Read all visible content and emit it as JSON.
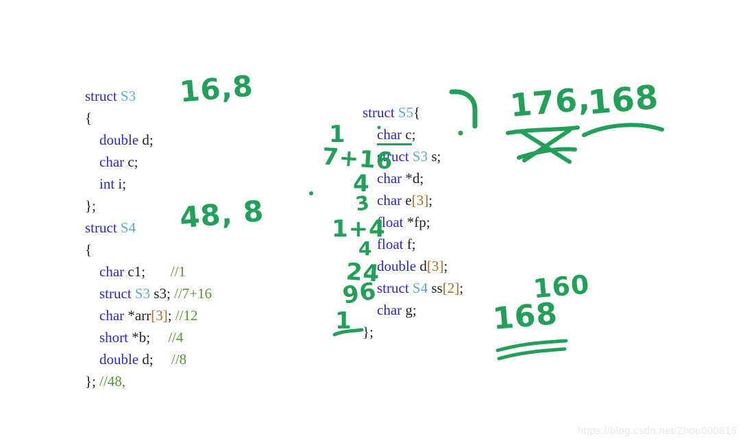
{
  "code_blocks": {
    "s3": {
      "lines": [
        [
          {
            "t": "struct ",
            "c": "kw"
          },
          {
            "t": "S3",
            "c": "typ"
          }
        ],
        [
          {
            "t": "{",
            "c": "id"
          }
        ],
        [
          {
            "t": "    ",
            "c": "id"
          },
          {
            "t": "double",
            "c": "kw"
          },
          {
            "t": " d;",
            "c": "id"
          }
        ],
        [
          {
            "t": "    ",
            "c": "id"
          },
          {
            "t": "char",
            "c": "kw"
          },
          {
            "t": " c;",
            "c": "id"
          }
        ],
        [
          {
            "t": "    ",
            "c": "id"
          },
          {
            "t": "int",
            "c": "kw"
          },
          {
            "t": " i;",
            "c": "id"
          }
        ],
        [
          {
            "t": "};",
            "c": "id"
          }
        ]
      ]
    },
    "s4": {
      "lines": [
        [
          {
            "t": "struct ",
            "c": "kw"
          },
          {
            "t": "S4",
            "c": "typ"
          }
        ],
        [
          {
            "t": "{",
            "c": "id"
          }
        ],
        [
          {
            "t": "    ",
            "c": "id"
          },
          {
            "t": "char",
            "c": "kw"
          },
          {
            "t": " c1;       ",
            "c": "id"
          },
          {
            "t": "//1",
            "c": "cmt"
          }
        ],
        [
          {
            "t": "    ",
            "c": "id"
          },
          {
            "t": "struct ",
            "c": "kw"
          },
          {
            "t": "S3",
            "c": "typ"
          },
          {
            "t": " s3; ",
            "c": "id"
          },
          {
            "t": "//7+16",
            "c": "cmt"
          }
        ],
        [
          {
            "t": "    ",
            "c": "id"
          },
          {
            "t": "char",
            "c": "kw"
          },
          {
            "t": " *arr",
            "c": "id"
          },
          {
            "t": "[3]",
            "c": "brk"
          },
          {
            "t": "; ",
            "c": "id"
          },
          {
            "t": "//12",
            "c": "cmt"
          }
        ],
        [
          {
            "t": "    ",
            "c": "id"
          },
          {
            "t": "short",
            "c": "kw"
          },
          {
            "t": " *b;     ",
            "c": "id"
          },
          {
            "t": "//4",
            "c": "cmt"
          }
        ],
        [
          {
            "t": "    ",
            "c": "id"
          },
          {
            "t": "double",
            "c": "kw"
          },
          {
            "t": " d;     ",
            "c": "id"
          },
          {
            "t": "//8",
            "c": "cmt"
          }
        ],
        [
          {
            "t": "}; ",
            "c": "id"
          },
          {
            "t": "//48,",
            "c": "cmt"
          }
        ]
      ]
    },
    "s5": {
      "lines": [
        [
          {
            "t": "struct ",
            "c": "kw"
          },
          {
            "t": "S5",
            "c": "typ"
          },
          {
            "t": "{",
            "c": "id"
          }
        ],
        [
          {
            "t": "    ",
            "c": "id"
          },
          {
            "t": "char",
            "c": "kw u"
          },
          {
            "t": " c",
            "c": "id u"
          },
          {
            "t": ";",
            "c": "id"
          }
        ],
        [
          {
            "t": "    ",
            "c": "id"
          },
          {
            "t": "struct ",
            "c": "kw"
          },
          {
            "t": "S3",
            "c": "typ"
          },
          {
            "t": " s;",
            "c": "id"
          }
        ],
        [
          {
            "t": "    ",
            "c": "id"
          },
          {
            "t": "char",
            "c": "kw"
          },
          {
            "t": " *d;",
            "c": "id"
          }
        ],
        [
          {
            "t": "    ",
            "c": "id"
          },
          {
            "t": "char",
            "c": "kw"
          },
          {
            "t": " e",
            "c": "id"
          },
          {
            "t": "[3]",
            "c": "brk"
          },
          {
            "t": ";",
            "c": "id"
          }
        ],
        [
          {
            "t": "    ",
            "c": "id"
          },
          {
            "t": "float",
            "c": "kw"
          },
          {
            "t": " *fp;",
            "c": "id"
          }
        ],
        [
          {
            "t": "    ",
            "c": "id"
          },
          {
            "t": "float",
            "c": "kw"
          },
          {
            "t": " f;",
            "c": "id"
          }
        ],
        [
          {
            "t": "    ",
            "c": "id"
          },
          {
            "t": "double",
            "c": "kw"
          },
          {
            "t": " d",
            "c": "id"
          },
          {
            "t": "[3]",
            "c": "brk"
          },
          {
            "t": ";",
            "c": "id"
          }
        ],
        [
          {
            "t": "    ",
            "c": "id"
          },
          {
            "t": "struct ",
            "c": "kw"
          },
          {
            "t": "S4",
            "c": "typ"
          },
          {
            "t": " ss",
            "c": "id"
          },
          {
            "t": "[2]",
            "c": "brk"
          },
          {
            "t": ";",
            "c": "id"
          }
        ],
        [
          {
            "t": "    ",
            "c": "id"
          },
          {
            "t": "char",
            "c": "kw"
          },
          {
            "t": " g;",
            "c": "id"
          }
        ],
        [
          {
            "t": "};",
            "c": "id"
          }
        ]
      ]
    }
  },
  "annotations": {
    "s3_size": "16,8",
    "s4_size": "48, 8",
    "s5_total_crossed": "176,",
    "s5_total_final": "168",
    "member_offsets": {
      "char_c": "1",
      "struct_s3_s": "7+16",
      "char_ptr_d": "4",
      "char_e3": "3",
      "float_ptr_fp": "1+4",
      "float_f": "4",
      "double_d3": "24",
      "struct_s4_ss2": "96",
      "char_g": "1"
    },
    "ss_array_size": "160",
    "final_total": "168"
  },
  "watermark": {
    "text": "https://blog.csdn.net/Zhou000815"
  },
  "colors": {
    "ink_green": "#22a05a",
    "keyword_blue": "#2b26d6",
    "type_cyan": "#5aa8dd",
    "comment_green": "#4f9b2e",
    "bracket_orange": "#b06a1c",
    "background": "#ffffff"
  }
}
